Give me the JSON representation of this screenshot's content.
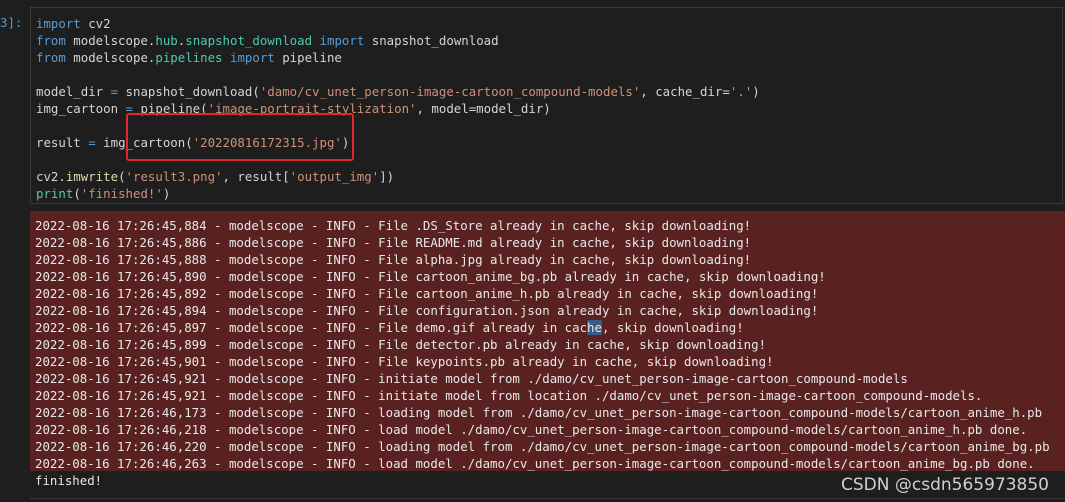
{
  "prompt": "3]:",
  "code": {
    "line1": [
      "import",
      " cv2"
    ],
    "line2": [
      "from",
      " modelscope.",
      "hub",
      ".",
      "snapshot_download",
      " ",
      "import",
      " snapshot_download"
    ],
    "line3": [
      "from",
      " modelscope.",
      "pipelines",
      " ",
      "import",
      " pipeline"
    ],
    "line5": [
      "model_dir ",
      "=",
      " snapshot_download(",
      "'damo/cv_unet_person-image-cartoon_compound-models'",
      ", cache_dir=",
      "'.'",
      ")"
    ],
    "line6": [
      "img_cartoon ",
      "=",
      " pipeline(",
      "'image-portrait-stylization'",
      ", model=model_dir)"
    ],
    "line8": [
      "result ",
      "=",
      " img_cartoon(",
      "'20220816172315.jpg'",
      ")"
    ],
    "line10": [
      "cv2.",
      "imwrite",
      "(",
      "'result3.png'",
      ", result[",
      "'output_img'",
      "])"
    ],
    "line11": [
      "print",
      "(",
      "'finished!'",
      ")"
    ]
  },
  "log": [
    "2022-08-16 17:26:45,884 - modelscope - INFO - File .DS_Store already in cache, skip downloading!",
    "2022-08-16 17:26:45,886 - modelscope - INFO - File README.md already in cache, skip downloading!",
    "2022-08-16 17:26:45,888 - modelscope - INFO - File alpha.jpg already in cache, skip downloading!",
    "2022-08-16 17:26:45,890 - modelscope - INFO - File cartoon_anime_bg.pb already in cache, skip downloading!",
    "2022-08-16 17:26:45,892 - modelscope - INFO - File cartoon_anime_h.pb already in cache, skip downloading!",
    "2022-08-16 17:26:45,894 - modelscope - INFO - File configuration.json already in cache, skip downloading!",
    [
      "2022-08-16 17:26:45,897 - modelscope - INFO - File demo.gif already in cac",
      "he",
      ", skip downloading!"
    ],
    "2022-08-16 17:26:45,899 - modelscope - INFO - File detector.pb already in cache, skip downloading!",
    "2022-08-16 17:26:45,901 - modelscope - INFO - File keypoints.pb already in cache, skip downloading!",
    "2022-08-16 17:26:45,921 - modelscope - INFO - initiate model from ./damo/cv_unet_person-image-cartoon_compound-models",
    "2022-08-16 17:26:45,921 - modelscope - INFO - initiate model from location ./damo/cv_unet_person-image-cartoon_compound-models.",
    "2022-08-16 17:26:46,173 - modelscope - INFO - loading model from ./damo/cv_unet_person-image-cartoon_compound-models/cartoon_anime_h.pb",
    "2022-08-16 17:26:46,218 - modelscope - INFO - load model ./damo/cv_unet_person-image-cartoon_compound-models/cartoon_anime_h.pb done.",
    "2022-08-16 17:26:46,220 - modelscope - INFO - loading model from ./damo/cv_unet_person-image-cartoon_compound-models/cartoon_anime_bg.pb",
    "2022-08-16 17:26:46,263 - modelscope - INFO - load model ./damo/cv_unet_person-image-cartoon_compound-models/cartoon_anime_bg.pb done."
  ],
  "finished": "finished!",
  "watermark": "CSDN @csdn565973850",
  "colors": {
    "keyword": "#569cd6",
    "module": "#4ec9b0",
    "string": "#ce9178",
    "function": "#dcdcaa",
    "output_bg": "#5a2121",
    "highlight_box": "#e0282c"
  }
}
